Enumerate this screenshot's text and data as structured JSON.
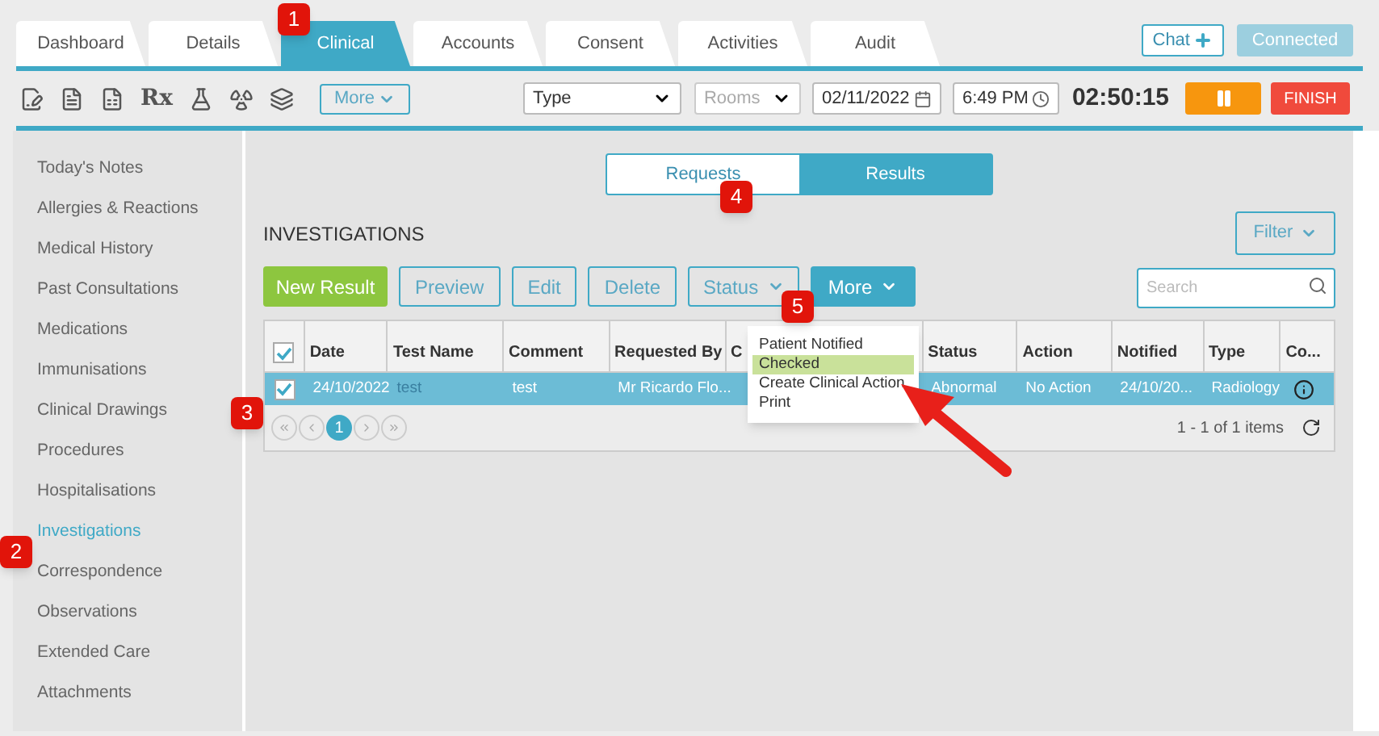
{
  "tabs": [
    {
      "label": "Dashboard",
      "selected": false
    },
    {
      "label": "Details",
      "selected": false
    },
    {
      "label": "Clinical",
      "selected": true
    },
    {
      "label": "Accounts",
      "selected": false
    },
    {
      "label": "Consent",
      "selected": false
    },
    {
      "label": "Activities",
      "selected": false
    },
    {
      "label": "Audit",
      "selected": false
    }
  ],
  "top_buttons": {
    "chat": "Chat",
    "connected": "Connected"
  },
  "toolbar": {
    "rx": "Rx",
    "more": "More",
    "type_select": "Type",
    "rooms_select": "Rooms",
    "date": "02/11/2022",
    "time": "6:49 PM",
    "timer": "02:50:15",
    "finish": "FINISH"
  },
  "sidebar": {
    "items": [
      {
        "label": "Today's Notes",
        "selected": false
      },
      {
        "label": "Allergies & Reactions",
        "selected": false
      },
      {
        "label": "Medical History",
        "selected": false
      },
      {
        "label": "Past Consultations",
        "selected": false
      },
      {
        "label": "Medications",
        "selected": false
      },
      {
        "label": "Immunisations",
        "selected": false
      },
      {
        "label": "Clinical Drawings",
        "selected": false
      },
      {
        "label": "Procedures",
        "selected": false
      },
      {
        "label": "Hospitalisations",
        "selected": false
      },
      {
        "label": "Investigations",
        "selected": true
      },
      {
        "label": "Correspondence",
        "selected": false
      },
      {
        "label": "Observations",
        "selected": false
      },
      {
        "label": "Extended Care",
        "selected": false
      },
      {
        "label": "Attachments",
        "selected": false
      }
    ]
  },
  "segments": [
    {
      "label": "Requests",
      "selected": false
    },
    {
      "label": "Results",
      "selected": true
    }
  ],
  "heading": "INVESTIGATIONS",
  "filter": "Filter",
  "actions": [
    {
      "label": "New Result",
      "kind": "primary"
    },
    {
      "label": "Preview",
      "kind": "outline"
    },
    {
      "label": "Edit",
      "kind": "outline"
    },
    {
      "label": "Delete",
      "kind": "outline"
    },
    {
      "label": "Status",
      "kind": "dropdown"
    },
    {
      "label": "More",
      "kind": "open"
    }
  ],
  "search": {
    "placeholder": "Search"
  },
  "table": {
    "all_checked": true,
    "columns": [
      "Date",
      "Test Name",
      "Comment",
      "Requested By",
      "C",
      "Status",
      "Action",
      "Notified",
      "Type",
      "Co..."
    ],
    "rows": [
      {
        "checked": true,
        "selected": true,
        "cells": [
          "24/10/2022",
          "test",
          "test",
          "Mr Ricardo Flo...",
          "",
          "Abnormal",
          "No Action",
          "24/10/20...",
          "Radiology",
          ""
        ]
      }
    ],
    "pages": [
      {
        "label": "1",
        "selected": true
      }
    ],
    "summary": "1 - 1 of 1 items"
  },
  "menu": [
    {
      "label": "Patient Notified",
      "selected": false
    },
    {
      "label": "Checked",
      "selected": true
    },
    {
      "label": "Create Clinical Action",
      "selected": false
    },
    {
      "label": "Print",
      "selected": false
    }
  ],
  "callouts": [
    "1",
    "2",
    "3",
    "4",
    "5"
  ]
}
